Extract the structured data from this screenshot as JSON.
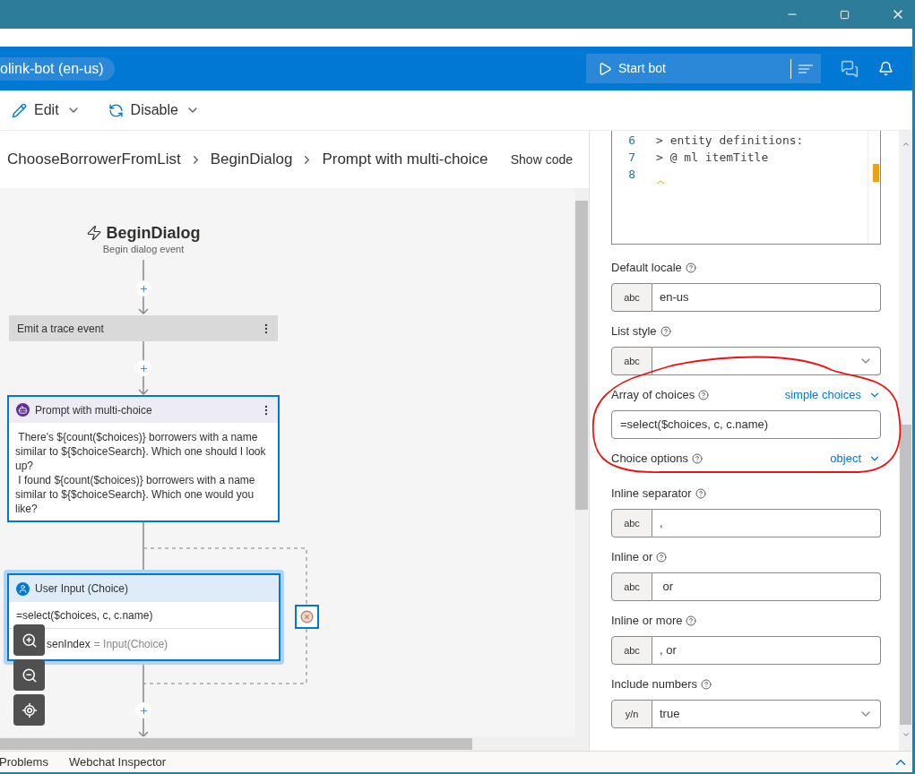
{
  "header": {
    "bot_name": "olink-bot (en-us)",
    "start_button": "Start bot"
  },
  "toolbar": [
    {
      "kind": "edit",
      "label": "Edit"
    },
    {
      "kind": "disable",
      "label": "Disable"
    }
  ],
  "breadcrumb": [
    "ChooseBorrowerFromList",
    "BeginDialog",
    "Prompt with multi-choice"
  ],
  "show_code": "Show code",
  "canvas": {
    "trigger": {
      "title": "BeginDialog",
      "subtitle": "Begin dialog event"
    },
    "action": {
      "title": "Emit a trace event"
    },
    "prompt": {
      "title": "Prompt with multi-choice",
      "lines": [
        " There's ${count($choices)} borrowers with a name similar to ${$choiceSearch}. Which one should I look up?",
        " I found ${count($choices)} borrowers with a name similar to ${$choiceSearch}. Which one would you like?"
      ]
    },
    "input": {
      "title": "User Input (Choice)",
      "selected": true,
      "choices": "=select($choices, c, c.name)",
      "variable": "senIndex",
      "assignment": "= Input(Choice)"
    }
  },
  "editor": {
    "lines": [
      {
        "number": "6",
        "text": "> entity definitions:"
      },
      {
        "number": "7",
        "text": "> @ ml itemTitle"
      },
      {
        "number": "8"
      }
    ]
  },
  "properties": [
    {
      "kind": "text",
      "label": "Default locale",
      "tag": "abc",
      "value": "en-us"
    },
    {
      "kind": "select",
      "label": "List style",
      "tag": "abc"
    },
    {
      "kind": "text",
      "label": "Array of choices",
      "mode": "simple choices",
      "value": "=select($choices, c, c.name)"
    },
    {
      "kind": "mode",
      "label": "Choice options",
      "mode": "object"
    },
    {
      "kind": "text",
      "label": "Inline separator",
      "tag": "abc",
      "value": ","
    },
    {
      "kind": "text",
      "label": "Inline or",
      "tag": "abc",
      "value": " or"
    },
    {
      "kind": "text",
      "label": "Inline or more",
      "tag": "abc",
      "value": ", or"
    },
    {
      "kind": "select",
      "label": "Include numbers",
      "tag": "y/n",
      "value": "true"
    }
  ],
  "bottom_tabs": [
    "Problems",
    "Webchat Inspector"
  ]
}
